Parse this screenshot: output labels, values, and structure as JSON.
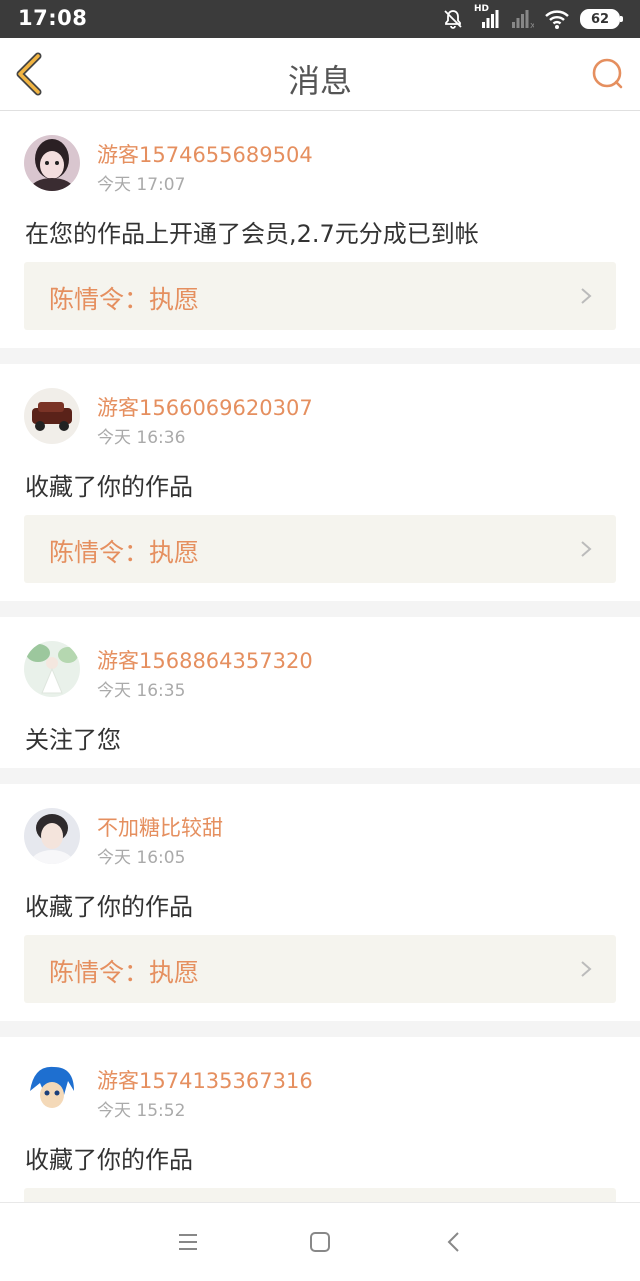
{
  "status_bar": {
    "time": "17:08",
    "battery": "62",
    "network_label": "HD"
  },
  "header": {
    "title": "消息"
  },
  "messages": [
    {
      "username": "游客1574655689504",
      "time": "今天 17:07",
      "text": "在您的作品上开通了会员,2.7元分成已到帐",
      "work": "陈情令：执愿"
    },
    {
      "username": "游客1566069620307",
      "time": "今天 16:36",
      "text": "收藏了你的作品",
      "work": "陈情令：执愿"
    },
    {
      "username": "游客1568864357320",
      "time": "今天 16:35",
      "text": "关注了您"
    },
    {
      "username": "不加糖比较甜",
      "time": "今天 16:05",
      "text": "收藏了你的作品",
      "work": "陈情令：执愿"
    },
    {
      "username": "游客1574135367316",
      "time": "今天 15:52",
      "text": "收藏了你的作品"
    }
  ],
  "colors": {
    "accent": "#e58f5f",
    "back_icon": "#f2b542",
    "status_bar_bg": "#3b3b3b",
    "work_bg": "#f5f4ee"
  },
  "icons": {
    "back": "chevron-left-icon",
    "search": "search-icon",
    "work_arrow": "chevron-right-icon",
    "nav_menu": "menu-icon",
    "nav_home": "square-icon",
    "nav_back": "triangle-back-icon"
  }
}
